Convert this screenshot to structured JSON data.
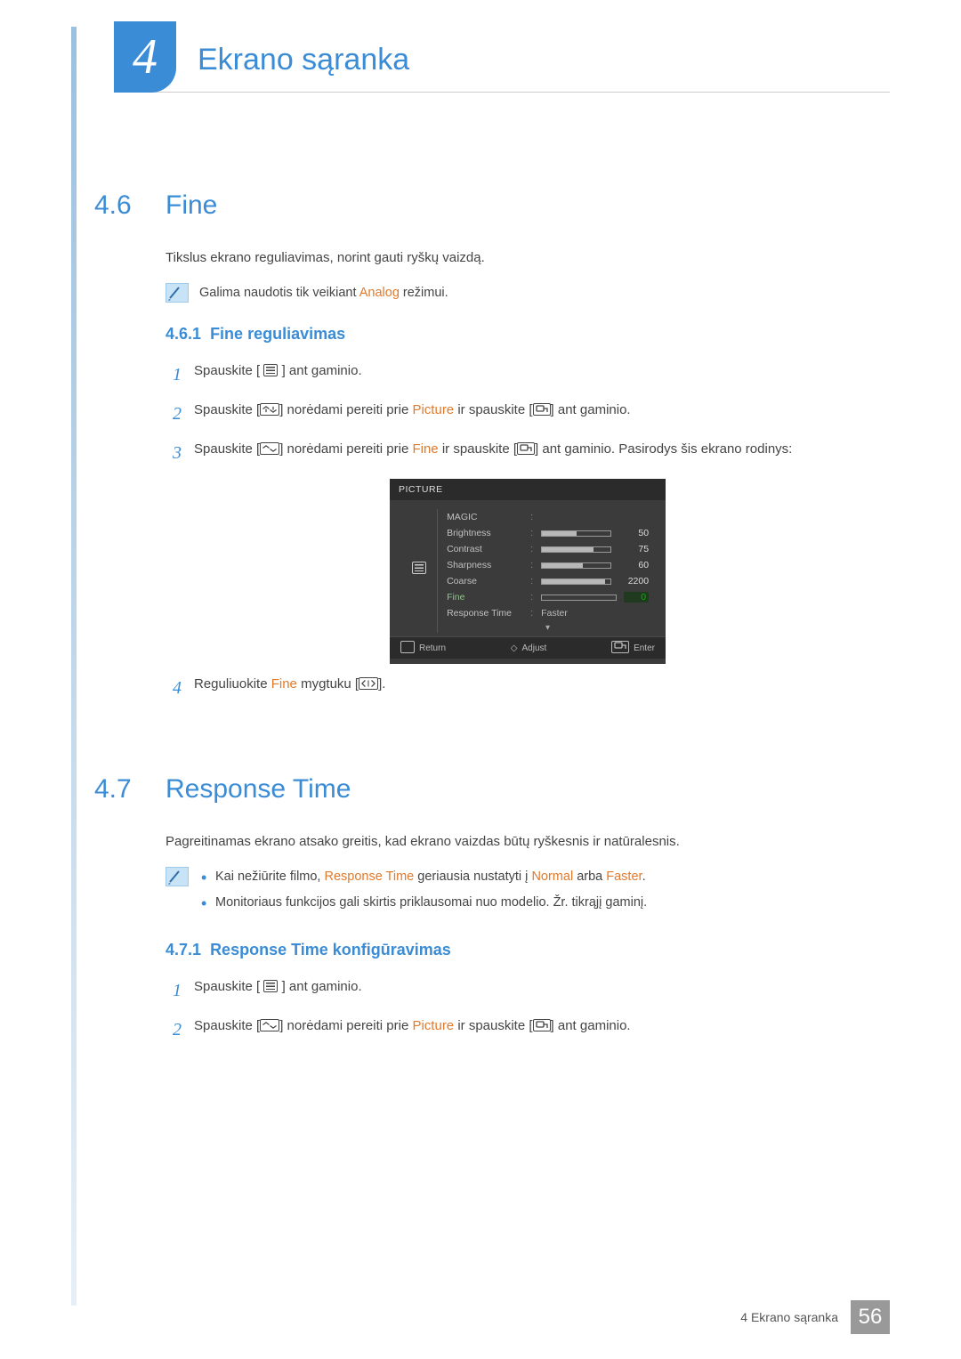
{
  "chapter": {
    "number": "4",
    "title": "Ekrano sąranka"
  },
  "s46": {
    "num": "4.6",
    "title": "Fine",
    "intro": "Tikslus ekrano reguliavimas, norint gauti ryškų vaizdą.",
    "note_pre": "Galima naudotis tik veikiant ",
    "note_kw": "Analog",
    "note_post": " režimui.",
    "sub": {
      "num": "4.6.1",
      "title": "Fine reguliavimas"
    },
    "steps": {
      "s1": "Spauskite [",
      "s1b": "] ant gaminio.",
      "s2a": "Spauskite [",
      "s2b": "] norėdami pereiti prie ",
      "s2_kw": "Picture",
      "s2c": " ir spauskite [",
      "s2d": "] ant gaminio.",
      "s3a": "Spauskite [",
      "s3b": "] norėdami pereiti prie ",
      "s3_kw": "Fine",
      "s3c": " ir spauskite [",
      "s3d": "] ant gaminio. Pasirodys šis ekrano rodinys:",
      "s4a": "Reguliuokite ",
      "s4_kw": "Fine",
      "s4b": " mygtuku [",
      "s4c": "]."
    }
  },
  "osd": {
    "title": "PICTURE",
    "rows": [
      {
        "label": "MAGIC",
        "type": "sub"
      },
      {
        "label": "Brightness",
        "type": "bar",
        "value": 50,
        "max": 100
      },
      {
        "label": "Contrast",
        "type": "bar",
        "value": 75,
        "max": 100
      },
      {
        "label": "Sharpness",
        "type": "bar",
        "value": 60,
        "max": 100
      },
      {
        "label": "Coarse",
        "type": "bar",
        "value": 2200,
        "max": 2400
      },
      {
        "label": "Fine",
        "type": "bar_hl",
        "value": 0,
        "max": 100
      },
      {
        "label": "Response Time",
        "type": "text",
        "value": "Faster"
      }
    ],
    "footer": {
      "return": "Return",
      "adjust": "Adjust",
      "enter": "Enter"
    }
  },
  "s47": {
    "num": "4.7",
    "title": "Response Time",
    "intro": "Pagreitinamas ekrano atsako greitis, kad ekrano vaizdas būtų ryškesnis ir natūralesnis.",
    "note1_a": "Kai nežiūrite filmo, ",
    "note1_kw1": "Response Time",
    "note1_b": " geriausia nustatyti į ",
    "note1_kw2": "Normal",
    "note1_c": " arba ",
    "note1_kw3": "Faster",
    "note1_d": ".",
    "note2": "Monitoriaus funkcijos gali skirtis priklausomai nuo modelio. Žr. tikrąjį gaminį.",
    "sub": {
      "num": "4.7.1",
      "title": "Response Time konfigūravimas"
    },
    "steps": {
      "s1": "Spauskite [",
      "s1b": "] ant gaminio.",
      "s2a": "Spauskite [",
      "s2b": "] norėdami pereiti prie ",
      "s2_kw": "Picture",
      "s2c": " ir spauskite [",
      "s2d": "] ant gaminio."
    }
  },
  "footer": {
    "text": "4 Ekrano sąranka",
    "page": "56"
  }
}
